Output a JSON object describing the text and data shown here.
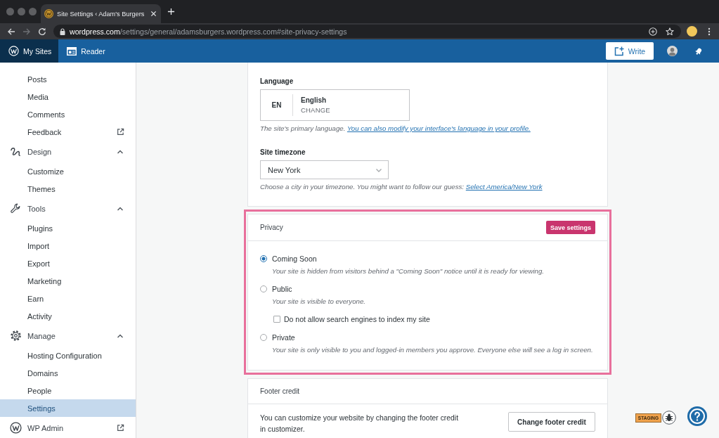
{
  "browser": {
    "tab": {
      "title": "Site Settings ‹ Adam's Burgers"
    },
    "address": {
      "domain": "wordpress.com",
      "path": "/settings/general/adamsburgers.wordpress.com#site-privacy-settings"
    }
  },
  "masterbar": {
    "items": [
      {
        "label": "My Sites",
        "selected": true
      },
      {
        "label": "Reader",
        "selected": false
      }
    ],
    "write_button": "Write"
  },
  "sidebar": {
    "items": [
      {
        "kind": "sublink",
        "label": "Posts",
        "selected": false
      },
      {
        "kind": "sublink",
        "label": "Media",
        "selected": false
      },
      {
        "kind": "sublink",
        "label": "Comments",
        "selected": false
      },
      {
        "kind": "sublink",
        "label": "Feedback",
        "selected": false,
        "external": true
      },
      {
        "kind": "section",
        "label": "Design",
        "expanded": true,
        "children": [
          {
            "label": "Customize",
            "selected": false
          },
          {
            "label": "Themes",
            "selected": false
          }
        ]
      },
      {
        "kind": "section",
        "label": "Tools",
        "expanded": true,
        "children": [
          {
            "label": "Plugins",
            "selected": false
          },
          {
            "label": "Import",
            "selected": false
          },
          {
            "label": "Export",
            "selected": false
          },
          {
            "label": "Marketing",
            "selected": false
          },
          {
            "label": "Earn",
            "selected": false
          },
          {
            "label": "Activity",
            "selected": false
          }
        ]
      },
      {
        "kind": "section",
        "label": "Manage",
        "expanded": true,
        "children": [
          {
            "label": "Hosting Configuration",
            "selected": false
          },
          {
            "label": "Domains",
            "selected": false
          },
          {
            "label": "People",
            "selected": false
          },
          {
            "label": "Settings",
            "selected": true
          }
        ]
      },
      {
        "kind": "link",
        "label": "WP Admin",
        "selected": false,
        "external": true
      }
    ]
  },
  "settings": {
    "language": {
      "label": "Language",
      "code": "EN",
      "name": "English",
      "action": "CHANGE",
      "help": "The site's primary language.",
      "help_link": "You can also modify your interface's language in your profile."
    },
    "timezone": {
      "label": "Site timezone",
      "value": "New York",
      "help": "Choose a city in your timezone. You might want to follow our guess:",
      "help_link": "Select America/New York"
    }
  },
  "privacy": {
    "title": "Privacy",
    "highlighted": true,
    "save_button": "Save settings",
    "options": [
      {
        "label": "Coming Soon",
        "description": "Your site is hidden from visitors behind a \"Coming Soon\" notice until it is ready for viewing.",
        "selected": true
      },
      {
        "label": "Public",
        "description": "Your site is visible to everyone.",
        "selected": false,
        "checkbox": {
          "label": "Do not allow search engines to index my site",
          "checked": false
        }
      },
      {
        "label": "Private",
        "description": "Your site is only visible to you and logged-in members you approve. Everyone else will see a log in screen.",
        "selected": false
      }
    ]
  },
  "footer_credit": {
    "title": "Footer credit",
    "text": "You can customize your website by changing the footer credit in customizer.",
    "button": "Change footer credit"
  },
  "staging_badge": "STAGING"
}
